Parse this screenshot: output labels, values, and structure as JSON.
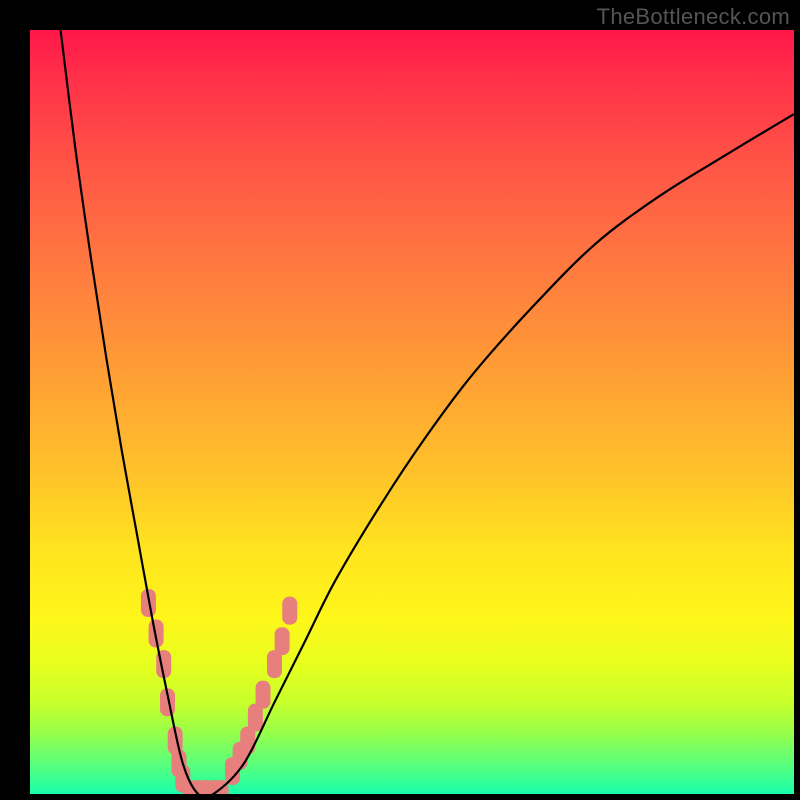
{
  "watermark": "TheBottleneck.com",
  "chart_data": {
    "type": "line",
    "title": "",
    "xlabel": "",
    "ylabel": "",
    "xlim": [
      0,
      100
    ],
    "ylim": [
      0,
      100
    ],
    "series": [
      {
        "name": "curve",
        "x": [
          4,
          6,
          8,
          10,
          12,
          14,
          16,
          18,
          20,
          22,
          24,
          28,
          32,
          36,
          40,
          46,
          52,
          58,
          66,
          74,
          82,
          90,
          100
        ],
        "y": [
          100,
          84,
          70,
          57,
          45,
          34,
          23,
          13,
          4,
          0,
          0,
          4,
          12,
          20,
          28,
          38,
          47,
          55,
          64,
          72,
          78,
          83,
          89
        ]
      }
    ],
    "markers": [
      {
        "name": "region-left",
        "color": "#e77f7d",
        "x": [
          15.5,
          16.5,
          17.5,
          18.0,
          19.0,
          19.5,
          20.0
        ],
        "y": [
          25,
          21,
          17,
          12,
          7,
          4,
          2
        ]
      },
      {
        "name": "region-bottom",
        "color": "#e77f7d",
        "x": [
          21.0,
          22.0,
          23.0,
          24.0,
          25.0
        ],
        "y": [
          0,
          0,
          0,
          0,
          0
        ]
      },
      {
        "name": "region-right",
        "color": "#e77f7d",
        "x": [
          26.5,
          27.5,
          28.5,
          29.5,
          30.5,
          32.0,
          33.0,
          34.0
        ],
        "y": [
          3,
          5,
          7,
          10,
          13,
          17,
          20,
          24
        ]
      }
    ],
    "colors": {
      "curve": "#000000",
      "marker": "#e77f7d",
      "gradient_top": "#ff1749",
      "gradient_mid": "#fff61a",
      "gradient_bottom": "#18ffab",
      "frame": "#000000",
      "watermark": "#555555"
    }
  }
}
